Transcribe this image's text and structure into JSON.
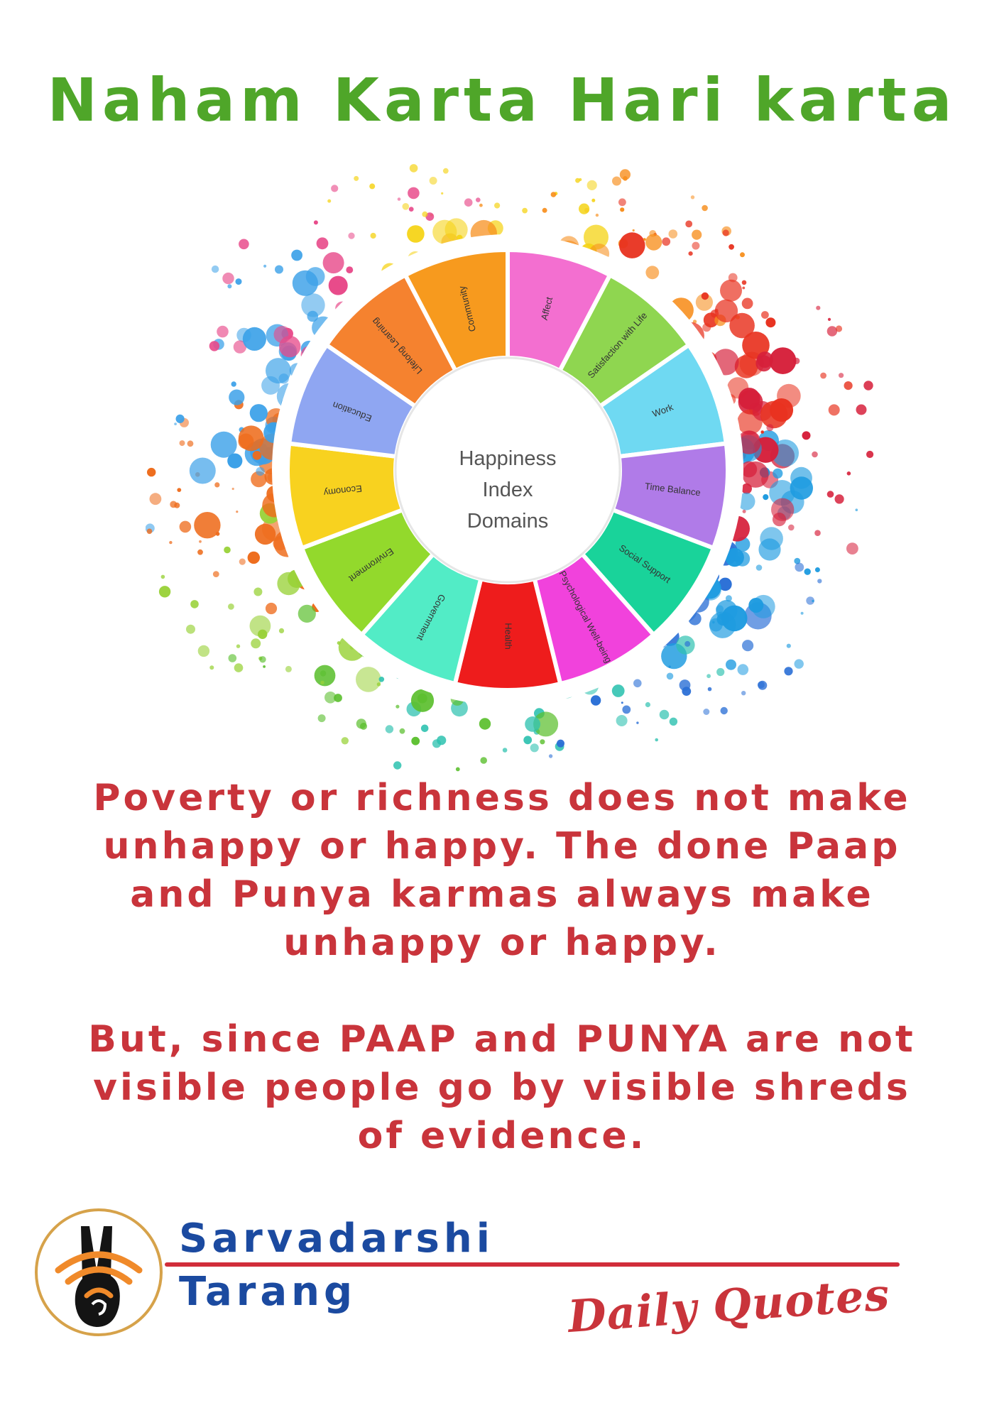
{
  "title": "Naham Karta Hari karta",
  "wheel": {
    "center_lines": [
      "Happiness",
      "Index",
      "Domains"
    ],
    "segments": [
      {
        "label": "Affect",
        "color": "#f36fd0"
      },
      {
        "label": "Satisfaction with Life",
        "color": "#8fd650"
      },
      {
        "label": "Work",
        "color": "#6fd9f2"
      },
      {
        "label": "Time Balance",
        "color": "#b07be8"
      },
      {
        "label": "Social Support",
        "color": "#19d39a"
      },
      {
        "label": "Psychological Well-being",
        "color": "#f142dc"
      },
      {
        "label": "Health",
        "color": "#ee1c1c"
      },
      {
        "label": "Government",
        "color": "#52ecc6"
      },
      {
        "label": "Environment",
        "color": "#93d92c"
      },
      {
        "label": "Economy",
        "color": "#f8d21f"
      },
      {
        "label": "Education",
        "color": "#8fa6f2"
      },
      {
        "label": "Lifelong Learning",
        "color": "#f5822f"
      },
      {
        "label": "Community",
        "color": "#f79a1e"
      }
    ]
  },
  "quote": {
    "line1": "Poverty or richness does not make",
    "line2": "unhappy or happy. The done Paap",
    "line3": "and Punya karmas always make",
    "line4": "unhappy or happy.",
    "line5": "But, since PAAP and PUNYA are not",
    "line6": "visible people go by visible shreds",
    "line7": "of evidence."
  },
  "brand": {
    "line1": "Sarvadarshi",
    "line2": "Tarang"
  },
  "tagline": "Daily Quotes",
  "colors": {
    "title": "#4fa629",
    "quote": "#c9343b",
    "brand": "#1b4aa0",
    "rule": "#d12d3a"
  }
}
